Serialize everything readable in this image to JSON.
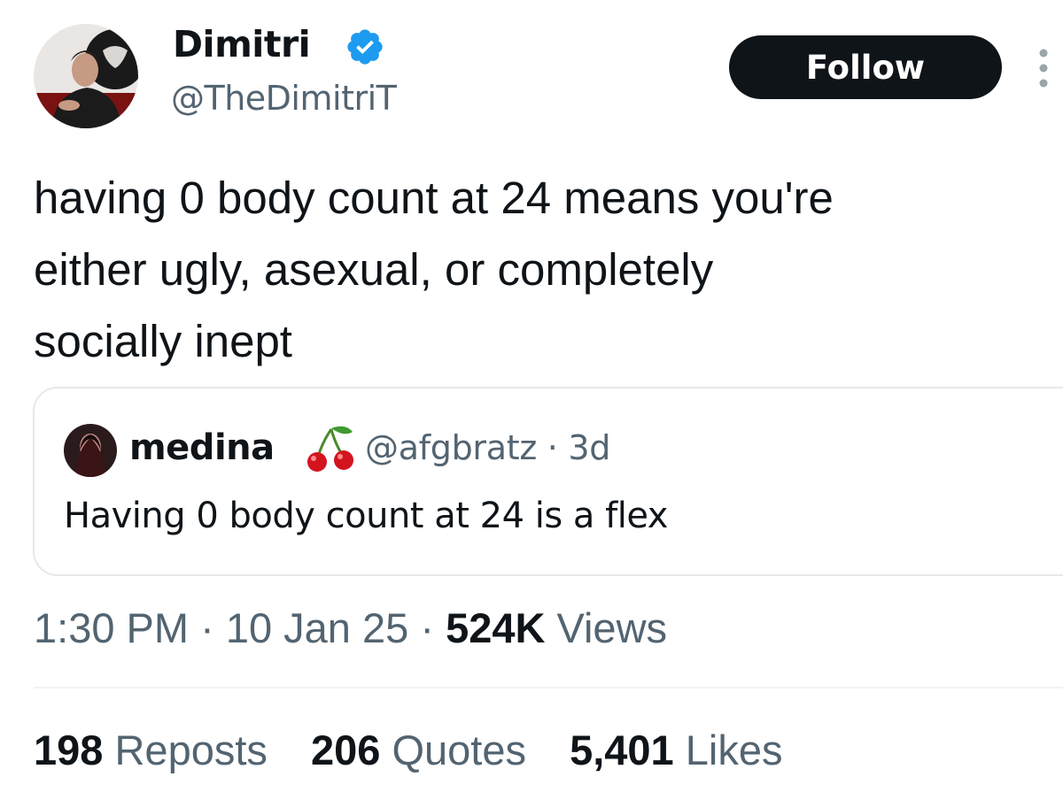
{
  "author": {
    "name": "Dimitri",
    "handle": "@TheDimitriT",
    "verified": true,
    "verified_color": "#1d9bf0"
  },
  "follow_label": "Follow",
  "more_icon": "more-vertical-icon",
  "tweet": {
    "text": "having 0 body count at 24 means you're\neither ugly, asexual, or completely\nsocially inept"
  },
  "quote": {
    "name": "medina",
    "emoji_icon": "cherry-icon",
    "handle": "@afgbratz",
    "separator": "·",
    "age": "3d",
    "text": "Having 0 body count at 24 is a flex"
  },
  "meta": {
    "time": "1:30 PM",
    "separator": "·",
    "date": "10 Jan 25",
    "views_count": "524K",
    "views_label": "Views"
  },
  "stats": {
    "reposts_count": "198",
    "reposts_label": "Reposts",
    "quotes_count": "206",
    "quotes_label": "Quotes",
    "likes_count": "5,401",
    "likes_label": "Likes"
  },
  "colors": {
    "text_primary": "#0f1419",
    "text_secondary": "#536471",
    "border": "#e5e9ec",
    "button_bg": "#0f1419"
  }
}
